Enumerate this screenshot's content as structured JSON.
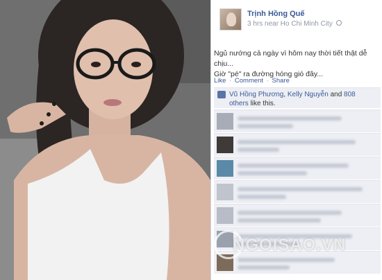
{
  "post": {
    "author": "Trịnh Hồng Quế",
    "meta_text": "3 hrs near Ho Chi Minh City",
    "text_line1": "Ngủ nướng cả ngày vì hôm nay thời tiết thật dễ chịu...",
    "text_line2": "Giờ \"pé\" ra đường hóng gió đây...",
    "action_like": "Like",
    "action_comment": "Comment",
    "action_share": "Share",
    "separator": "·",
    "likes": {
      "name1": "Vũ Hồng Phương",
      "sep1": ", ",
      "name2": "Kelly Nguyễn",
      "connector": " and ",
      "others": "808 others",
      "suffix": " like this."
    }
  },
  "watermark": "NGOISAO.VN",
  "colors": {
    "link": "#3b5998",
    "meta": "#9197a3",
    "comment_bg": "#edeff4"
  }
}
